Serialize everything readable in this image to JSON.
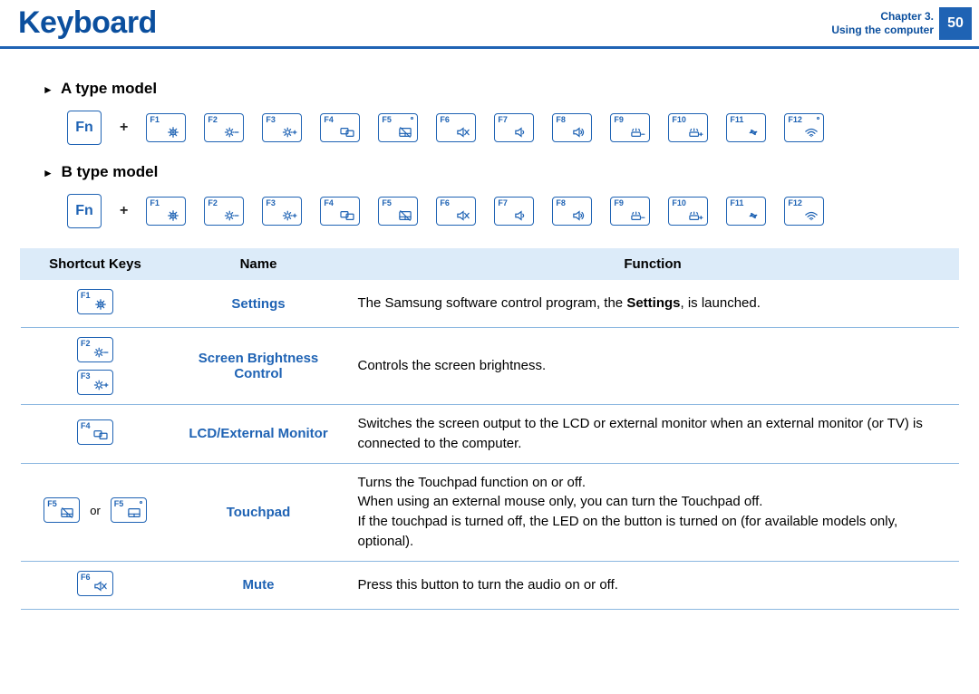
{
  "header": {
    "title": "Keyboard",
    "chapter_line1": "Chapter 3.",
    "chapter_line2": "Using the computer",
    "page_number": "50"
  },
  "sections": {
    "model_a_label": "A type model",
    "model_b_label": "B type model",
    "fn_label": "Fn",
    "plus": "+",
    "fkeys": [
      "F1",
      "F2",
      "F3",
      "F4",
      "F5",
      "F6",
      "F7",
      "F8",
      "F9",
      "F10",
      "F11",
      "F12"
    ]
  },
  "table": {
    "headers": {
      "sk": "Shortcut Keys",
      "name": "Name",
      "fn": "Function"
    },
    "rows": [
      {
        "keys": [
          "F1"
        ],
        "name": "Settings",
        "function_html": "The Samsung software control program, the <b>Settings</b>, is launched."
      },
      {
        "keys": [
          "F2",
          "F3"
        ],
        "name": "Screen Brightness Control",
        "function_html": "Controls the screen brightness."
      },
      {
        "keys": [
          "F4"
        ],
        "name": "LCD/External Monitor",
        "function_html": "Switches the screen output to the LCD or external monitor when an external monitor (or TV) is connected to the computer."
      },
      {
        "keys_or": [
          "F5",
          "F5"
        ],
        "or_text": "or",
        "name": "Touchpad",
        "function_html": "Turns the Touchpad function on or off.<br>When using an external mouse only, you can turn the Touchpad off.<br>If the touchpad is turned off, the LED on the button is turned on (for available models only, optional)."
      },
      {
        "keys": [
          "F6"
        ],
        "name": "Mute",
        "function_html": "Press this button to turn the audio on or off."
      }
    ]
  },
  "icons": {
    "F1": "gear",
    "F2": "sun-minus",
    "F3": "sun-plus",
    "F4": "monitor-dual",
    "F5": "touchpad-off",
    "F6": "mute",
    "F7": "vol-down",
    "F8": "vol-up",
    "F9": "kbd-light-minus",
    "F10": "kbd-light-plus",
    "F11": "fan",
    "F12": "wifi"
  },
  "a_dots": {
    "F5": true,
    "F12": true
  },
  "b_dots": {}
}
